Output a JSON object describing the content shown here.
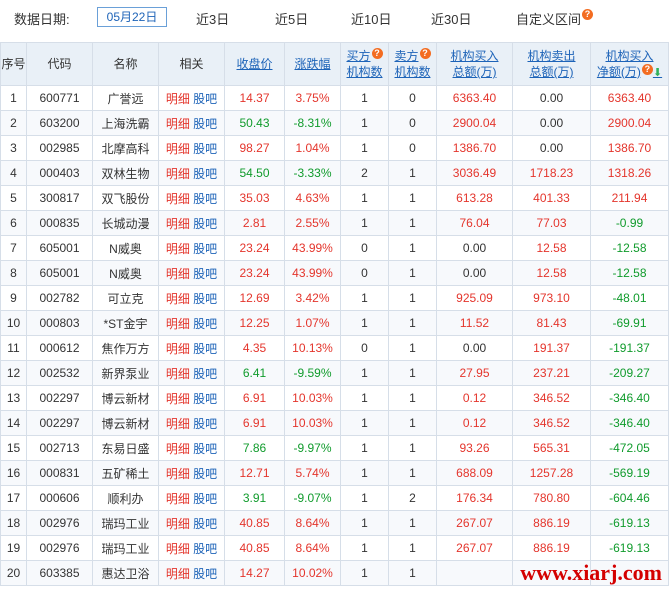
{
  "filter": {
    "label": "数据日期:",
    "date": "05月22日",
    "options": [
      "近3日",
      "近5日",
      "近10日",
      "近30日",
      "自定义区间"
    ]
  },
  "headers": {
    "idx": "序号",
    "code": "代码",
    "name": "名称",
    "related": "相关",
    "close": "收盘价",
    "change": "涨跌幅",
    "buy_count_1": "买方",
    "buy_count_2": "机构数",
    "sell_count_1": "卖方",
    "sell_count_2": "机构数",
    "buy_amt_1": "机构买入",
    "buy_amt_2": "总额(万)",
    "sell_amt_1": "机构卖出",
    "sell_amt_2": "总额(万)",
    "net_1": "机构买入",
    "net_2": "净额(万)"
  },
  "related_labels": {
    "detail": "明细",
    "guba": "股吧"
  },
  "rows": [
    {
      "idx": "1",
      "code": "600771",
      "name": "广誉远",
      "close": "14.37",
      "change": "3.75%",
      "buy": "1",
      "sell": "0",
      "buy_amt": "6363.40",
      "sell_amt": "0.00",
      "net": "6363.40"
    },
    {
      "idx": "2",
      "code": "603200",
      "name": "上海洗霸",
      "close": "50.43",
      "change": "-8.31%",
      "buy": "1",
      "sell": "0",
      "buy_amt": "2900.04",
      "sell_amt": "0.00",
      "net": "2900.04"
    },
    {
      "idx": "3",
      "code": "002985",
      "name": "北摩高科",
      "close": "98.27",
      "change": "1.04%",
      "buy": "1",
      "sell": "0",
      "buy_amt": "1386.70",
      "sell_amt": "0.00",
      "net": "1386.70"
    },
    {
      "idx": "4",
      "code": "000403",
      "name": "双林生物",
      "close": "54.50",
      "change": "-3.33%",
      "buy": "2",
      "sell": "1",
      "buy_amt": "3036.49",
      "sell_amt": "1718.23",
      "net": "1318.26"
    },
    {
      "idx": "5",
      "code": "300817",
      "name": "双飞股份",
      "close": "35.03",
      "change": "4.63%",
      "buy": "1",
      "sell": "1",
      "buy_amt": "613.28",
      "sell_amt": "401.33",
      "net": "211.94"
    },
    {
      "idx": "6",
      "code": "000835",
      "name": "长城动漫",
      "close": "2.81",
      "change": "2.55%",
      "buy": "1",
      "sell": "1",
      "buy_amt": "76.04",
      "sell_amt": "77.03",
      "net": "-0.99"
    },
    {
      "idx": "7",
      "code": "605001",
      "name": "N威奥",
      "close": "23.24",
      "change": "43.99%",
      "buy": "0",
      "sell": "1",
      "buy_amt": "0.00",
      "sell_amt": "12.58",
      "net": "-12.58"
    },
    {
      "idx": "8",
      "code": "605001",
      "name": "N威奥",
      "close": "23.24",
      "change": "43.99%",
      "buy": "0",
      "sell": "1",
      "buy_amt": "0.00",
      "sell_amt": "12.58",
      "net": "-12.58"
    },
    {
      "idx": "9",
      "code": "002782",
      "name": "可立克",
      "close": "12.69",
      "change": "3.42%",
      "buy": "1",
      "sell": "1",
      "buy_amt": "925.09",
      "sell_amt": "973.10",
      "net": "-48.01"
    },
    {
      "idx": "10",
      "code": "000803",
      "name": "*ST金宇",
      "close": "12.25",
      "change": "1.07%",
      "buy": "1",
      "sell": "1",
      "buy_amt": "11.52",
      "sell_amt": "81.43",
      "net": "-69.91"
    },
    {
      "idx": "11",
      "code": "000612",
      "name": "焦作万方",
      "close": "4.35",
      "change": "10.13%",
      "buy": "0",
      "sell": "1",
      "buy_amt": "0.00",
      "sell_amt": "191.37",
      "net": "-191.37"
    },
    {
      "idx": "12",
      "code": "002532",
      "name": "新界泵业",
      "close": "6.41",
      "change": "-9.59%",
      "buy": "1",
      "sell": "1",
      "buy_amt": "27.95",
      "sell_amt": "237.21",
      "net": "-209.27"
    },
    {
      "idx": "13",
      "code": "002297",
      "name": "博云新材",
      "close": "6.91",
      "change": "10.03%",
      "buy": "1",
      "sell": "1",
      "buy_amt": "0.12",
      "sell_amt": "346.52",
      "net": "-346.40"
    },
    {
      "idx": "14",
      "code": "002297",
      "name": "博云新材",
      "close": "6.91",
      "change": "10.03%",
      "buy": "1",
      "sell": "1",
      "buy_amt": "0.12",
      "sell_amt": "346.52",
      "net": "-346.40"
    },
    {
      "idx": "15",
      "code": "002713",
      "name": "东易日盛",
      "close": "7.86",
      "change": "-9.97%",
      "buy": "1",
      "sell": "1",
      "buy_amt": "93.26",
      "sell_amt": "565.31",
      "net": "-472.05"
    },
    {
      "idx": "16",
      "code": "000831",
      "name": "五矿稀土",
      "close": "12.71",
      "change": "5.74%",
      "buy": "1",
      "sell": "1",
      "buy_amt": "688.09",
      "sell_amt": "1257.28",
      "net": "-569.19"
    },
    {
      "idx": "17",
      "code": "000606",
      "name": "顺利办",
      "close": "3.91",
      "change": "-9.07%",
      "buy": "1",
      "sell": "2",
      "buy_amt": "176.34",
      "sell_amt": "780.80",
      "net": "-604.46"
    },
    {
      "idx": "18",
      "code": "002976",
      "name": "瑞玛工业",
      "close": "40.85",
      "change": "8.64%",
      "buy": "1",
      "sell": "1",
      "buy_amt": "267.07",
      "sell_amt": "886.19",
      "net": "-619.13"
    },
    {
      "idx": "19",
      "code": "002976",
      "name": "瑞玛工业",
      "close": "40.85",
      "change": "8.64%",
      "buy": "1",
      "sell": "1",
      "buy_amt": "267.07",
      "sell_amt": "886.19",
      "net": "-619.13"
    },
    {
      "idx": "20",
      "code": "603385",
      "name": "惠达卫浴",
      "close": "14.27",
      "change": "10.02%",
      "buy": "1",
      "sell": "1",
      "buy_amt": "",
      "sell_amt": "",
      "net": ""
    }
  ],
  "watermark": "www.xiarj.com"
}
